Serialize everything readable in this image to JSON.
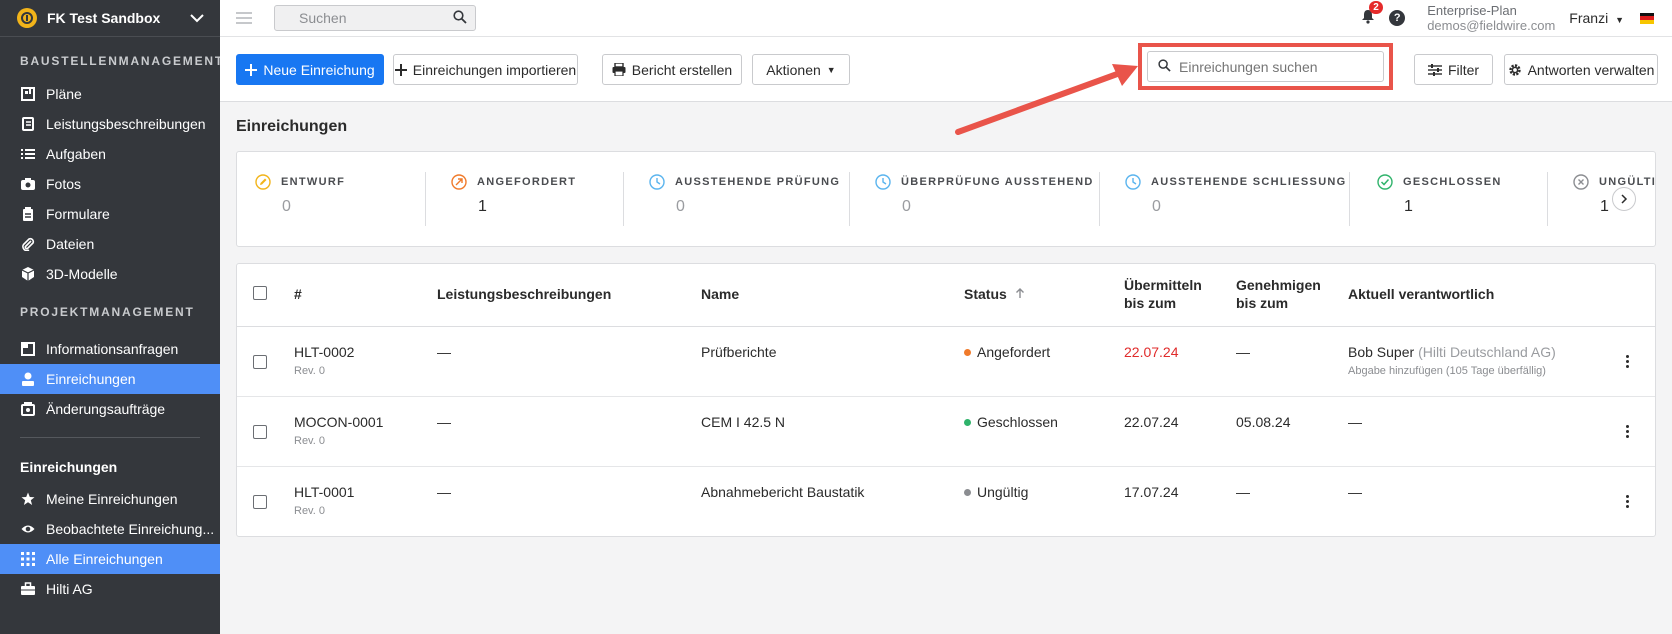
{
  "sidebar": {
    "project_name": "FK Test Sandbox",
    "section_construction": "BAUSTELLENMANAGEMENT",
    "construction_items": [
      {
        "label": "Pläne",
        "icon": "plans-icon"
      },
      {
        "label": "Leistungsbeschreibungen",
        "icon": "specs-icon"
      },
      {
        "label": "Aufgaben",
        "icon": "tasks-icon"
      },
      {
        "label": "Fotos",
        "icon": "camera-icon"
      },
      {
        "label": "Formulare",
        "icon": "forms-icon"
      },
      {
        "label": "Dateien",
        "icon": "paperclip-icon"
      },
      {
        "label": "3D-Modelle",
        "icon": "cube-icon"
      }
    ],
    "section_project": "PROJEKTMANAGEMENT",
    "project_items": [
      {
        "label": "Informationsanfragen",
        "icon": "rfi-icon"
      },
      {
        "label": "Einreichungen",
        "icon": "submittal-icon",
        "active": true
      },
      {
        "label": "Änderungsaufträge",
        "icon": "change-order-icon"
      }
    ],
    "subsection_title": "Einreichungen",
    "sub_items": [
      {
        "label": "Meine Einreichungen",
        "icon": "star-icon"
      },
      {
        "label": "Beobachtete Einreichung...",
        "icon": "eye-icon"
      },
      {
        "label": "Alle Einreichungen",
        "icon": "grid-icon",
        "active": true
      },
      {
        "label": "Hilti AG",
        "icon": "briefcase-icon"
      }
    ]
  },
  "topbar": {
    "search_placeholder": "Suchen",
    "notification_count": "2",
    "help": "?",
    "plan_name": "Enterprise-Plan",
    "plan_email": "demos@fieldwire.com",
    "user_name": "Franzi"
  },
  "toolbar": {
    "new_label": "Neue Einreichung",
    "import_label": "Einreichungen importieren",
    "report_label": "Bericht erstellen",
    "actions_label": "Aktionen",
    "search_placeholder": "Einreichungen suchen",
    "filter_label": "Filter",
    "manage_label": "Antworten verwalten"
  },
  "page_title": "Einreichungen",
  "stats": [
    {
      "label": "ENTWURF",
      "value": "0",
      "color": "#f2b41a"
    },
    {
      "label": "ANGEFORDERT",
      "value": "1",
      "color": "#f07a2a"
    },
    {
      "label": "AUSSTEHENDE PRÜFUNG",
      "value": "0",
      "color": "#5ab4ee"
    },
    {
      "label": "ÜBERPRÜFUNG AUSSTEHEND",
      "value": "0",
      "color": "#5ab4ee"
    },
    {
      "label": "AUSSTEHENDE SCHLIESSUNG",
      "value": "0",
      "color": "#5ab4ee"
    },
    {
      "label": "GESCHLOSSEN",
      "value": "1",
      "color": "#2fb36b"
    },
    {
      "label": "UNGÜLTIG",
      "value": "1",
      "color": "#8b8d91"
    }
  ],
  "table": {
    "headers": {
      "num": "#",
      "specs": "Leistungsbeschreibungen",
      "name": "Name",
      "status": "Status",
      "submit_by_1": "Übermitteln",
      "submit_by_2": "bis zum",
      "approve_by_1": "Genehmigen",
      "approve_by_2": "bis zum",
      "responsible": "Aktuell verantwortlich"
    },
    "rows": [
      {
        "id": "HLT-0002",
        "rev": "Rev. 0",
        "specs": "—",
        "name": "Prüfberichte",
        "status": "Angefordert",
        "status_color": "#f07a2a",
        "submit": "22.07.24",
        "submit_overdue": true,
        "approve": "—",
        "responsible": "Bob Super",
        "company": "(Hilti Deutschland AG)",
        "note": "Abgabe hinzufügen (105 Tage überfällig)"
      },
      {
        "id": "MOCON-0001",
        "rev": "Rev. 0",
        "specs": "—",
        "name": "CEM I 42.5 N",
        "status": "Geschlossen",
        "status_color": "#2fb36b",
        "submit": "22.07.24",
        "submit_overdue": false,
        "approve": "05.08.24",
        "responsible": "—",
        "company": "",
        "note": ""
      },
      {
        "id": "HLT-0001",
        "rev": "Rev. 0",
        "specs": "—",
        "name": "Abnahmebericht Baustatik",
        "status": "Ungültig",
        "status_color": "#8b8d91",
        "submit": "17.07.24",
        "submit_overdue": false,
        "approve": "—",
        "responsible": "—",
        "company": "",
        "note": ""
      }
    ]
  }
}
